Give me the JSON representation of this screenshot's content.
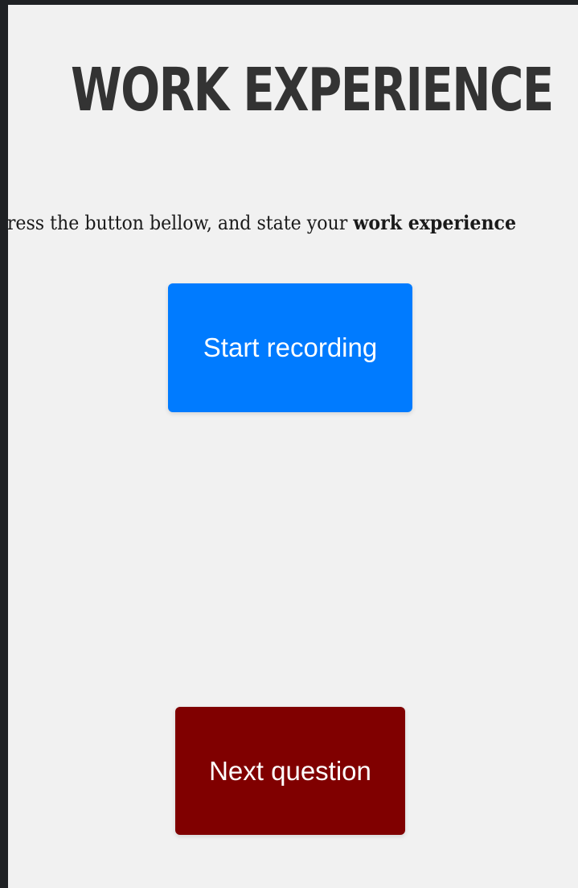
{
  "page": {
    "title": "WORK EXPERIENCE",
    "instruction_prefix": "Press the button bellow, and state your ",
    "instruction_bold": "work experience"
  },
  "buttons": {
    "record_label": "Start recording",
    "record_color": "#007bff",
    "next_label": "Next question",
    "next_color": "#800000"
  }
}
